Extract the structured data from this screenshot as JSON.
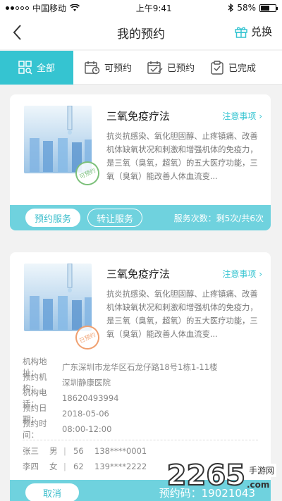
{
  "status_bar": {
    "carrier": "中国移动",
    "time": "上午9:41",
    "battery": "58%",
    "battery_level": 0.58
  },
  "nav": {
    "title": "我的预约",
    "exchange_label": "兑换"
  },
  "tabs": [
    {
      "label": "全部",
      "icon": "grid-search-icon",
      "active": true
    },
    {
      "label": "可预约",
      "icon": "calendar-clock-icon",
      "active": false
    },
    {
      "label": "已预约",
      "icon": "calendar-check-icon",
      "active": false
    },
    {
      "label": "已完成",
      "icon": "clipboard-check-icon",
      "active": false
    }
  ],
  "cards": [
    {
      "title": "三氧免疫疗法",
      "notice": "注意事项 ›",
      "description": "抗炎抗感染、氧化胆固醇、止疼镇痛、改善机体缺氧状况和刺激和增强机体的免疫力，是三氧（臭氧，超氧）的五大医疗功能，三氧（臭氧）能改善人体血流变...",
      "stamp": "可预约",
      "primary_btn": "预约服务",
      "secondary_btn": "转让服务",
      "uses": "服务次数：剩5次/共6次"
    },
    {
      "title": "三氧免疫疗法",
      "notice": "注意事项 ›",
      "description": "抗炎抗感染、氧化胆固醇、止疼镇痛、改善机体缺氧状况和刺激和增强机体的免疫力，是三氧（臭氧，超氧）的五大医疗功能，三氧（臭氧）能改善人体血流变...",
      "stamp": "已预约",
      "info": [
        {
          "key": "机构地址：",
          "value": "广东深圳市龙华区石龙仔路18号1栋1-11楼"
        },
        {
          "key": "预约机构：",
          "value": "深圳静康医院"
        },
        {
          "key": "机构电话：",
          "value": "18620493994"
        },
        {
          "key": "预约日期：",
          "value": "2018-05-06"
        },
        {
          "key": "预约时间：",
          "value": "08:00-12:00"
        }
      ],
      "people": [
        {
          "name": "张三",
          "gender": "男",
          "sep": "|",
          "age": "56",
          "phone": "138****0001"
        },
        {
          "name": "李四",
          "gender": "女",
          "sep": "|",
          "age": "62",
          "phone": "139****2222"
        }
      ],
      "cancel_btn": "取消",
      "code": "预约码：19021043"
    }
  ],
  "watermark": {
    "big": "2265",
    "small": "手游网",
    "domain": ".com"
  },
  "colors": {
    "accent": "#35c4d1",
    "footer": "#6fd2de"
  }
}
